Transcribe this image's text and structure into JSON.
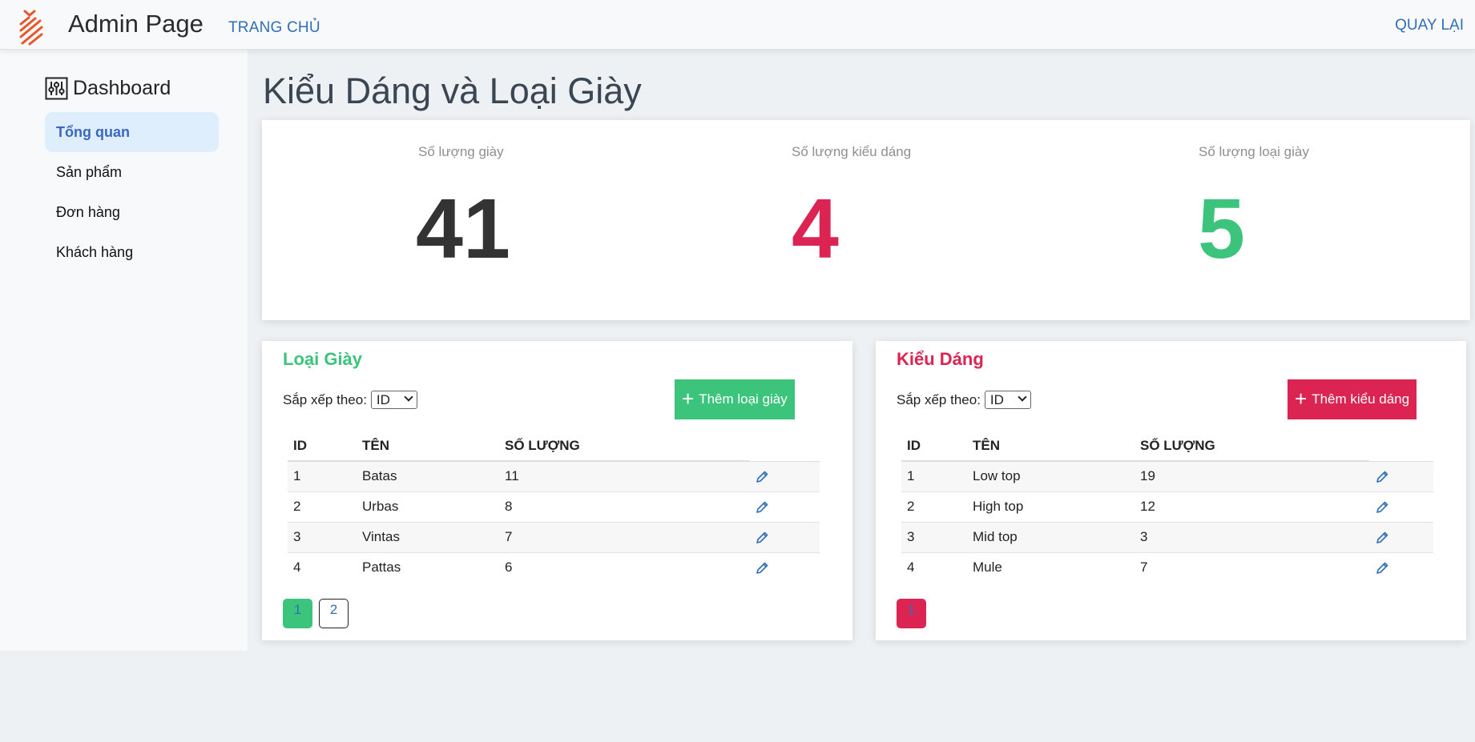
{
  "header": {
    "brand": "Admin Page",
    "nav_home": "TRANG CHỦ",
    "nav_back": "QUAY LẠI",
    "logo_icon": "striped-logo-icon",
    "accent": "#e8552a"
  },
  "sidebar": {
    "title": "Dashboard",
    "title_icon": "sliders-icon",
    "items": [
      {
        "label": "Tổng quan",
        "active": true
      },
      {
        "label": "Sản phẩm"
      },
      {
        "label": "Đơn hàng"
      },
      {
        "label": "Khách hàng"
      }
    ]
  },
  "main": {
    "title": "Kiểu Dáng và Loại Giày",
    "stats": [
      {
        "label": "Số lượng giày",
        "value": "41",
        "color": "#333333"
      },
      {
        "label": "Số lượng kiểu dáng",
        "value": "4",
        "color": "#dc2453"
      },
      {
        "label": "Số lượng loại giày",
        "value": "5",
        "color": "#3cc47c"
      }
    ]
  },
  "loai_giay": {
    "title": "Loại Giày",
    "color": "#3cc47c",
    "sort_label": "Sắp xếp theo:",
    "sort_value": "ID",
    "add_label": "Thêm loại giày",
    "columns": [
      "ID",
      "TÊN",
      "SỐ LƯỢNG"
    ],
    "rows": [
      [
        "1",
        "Batas",
        "11"
      ],
      [
        "2",
        "Urbas",
        "8"
      ],
      [
        "3",
        "Vintas",
        "7"
      ],
      [
        "4",
        "Pattas",
        "6"
      ]
    ],
    "pages": [
      "1",
      "2"
    ]
  },
  "kieu_dang": {
    "title": "Kiểu Dáng",
    "color": "#dc2453",
    "sort_label": "Sắp xếp theo:",
    "sort_value": "ID",
    "add_label": "Thêm kiểu dáng",
    "columns": [
      "ID",
      "TÊN",
      "SỐ LƯỢNG"
    ],
    "rows": [
      [
        "1",
        "Low top",
        "19"
      ],
      [
        "2",
        "High top",
        "12"
      ],
      [
        "3",
        "Mid top",
        "3"
      ],
      [
        "4",
        "Mule",
        "7"
      ]
    ],
    "pages": [
      "1"
    ]
  }
}
